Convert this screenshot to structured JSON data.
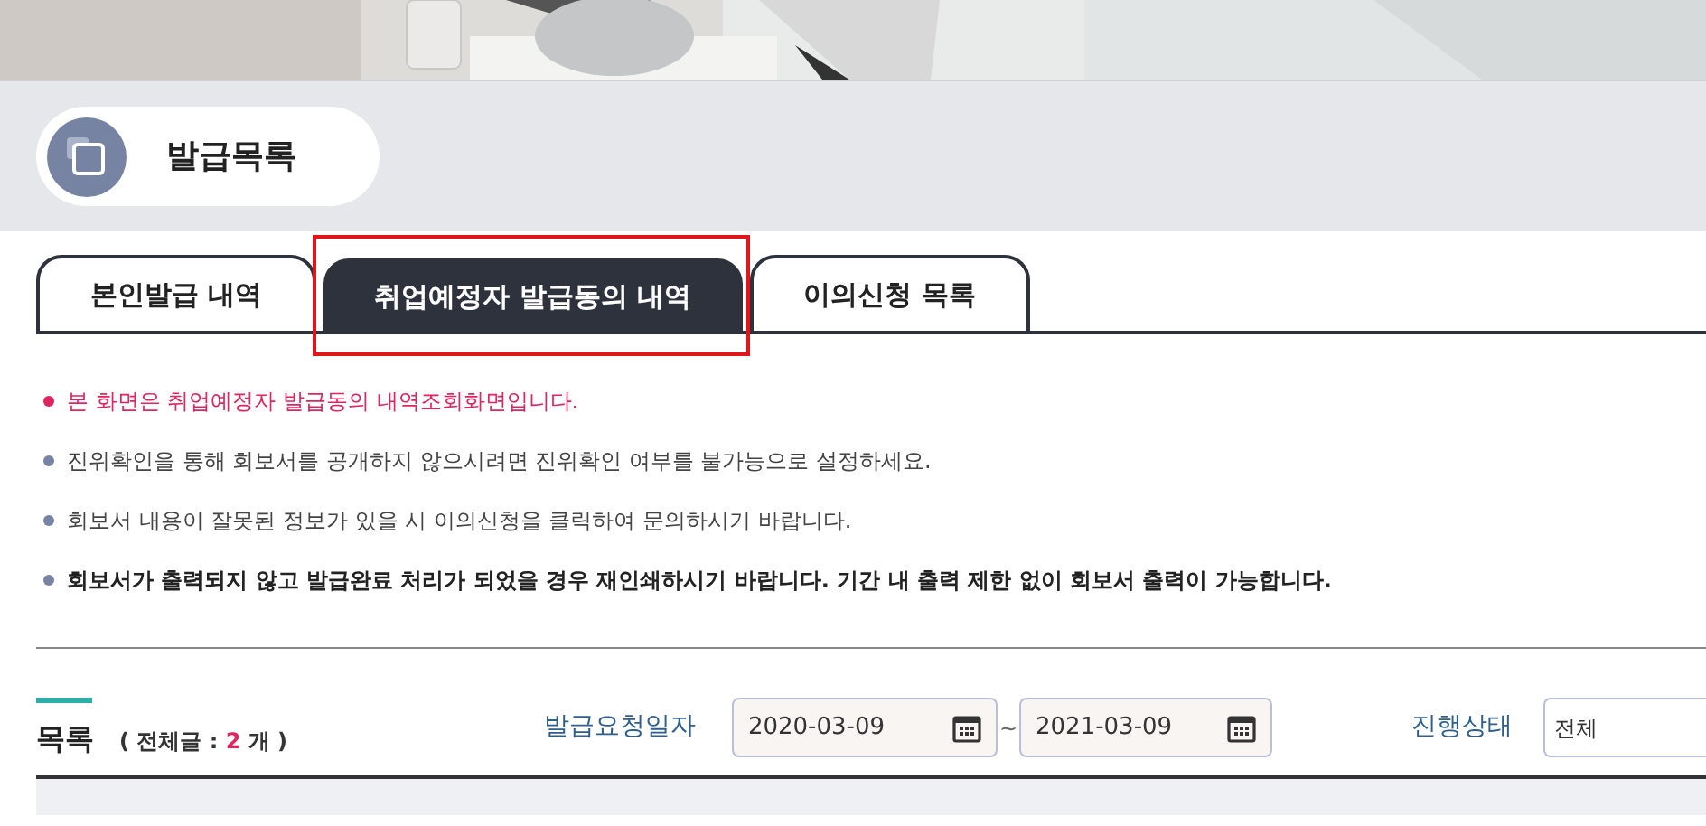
{
  "page_title": "발급목록",
  "tabs": [
    {
      "label": "본인발급 내역",
      "selected": false
    },
    {
      "label": "취업예정자 발급동의 내역",
      "selected": true
    },
    {
      "label": "이의신청 목록",
      "selected": false
    }
  ],
  "notices": [
    {
      "text": "본 화면은 취업예정자 발급동의 내역조회화면입니다.",
      "kind": "highlight"
    },
    {
      "text": "진위확인을 통해 회보서를 공개하지 않으시려면 진위확인 여부를 불가능으로 설정하세요.",
      "kind": "normal"
    },
    {
      "text": "회보서 내용이 잘못된 정보가 있을 시 이의신청을 클릭하여 문의하시기 바랍니다.",
      "kind": "normal"
    },
    {
      "text": "회보서가 출력되지 않고 발급완료 처리가 되었을 경우 재인쇄하시기 바랍니다. 기간 내 출력 제한 없이 회보서 출력이 가능합니다.",
      "kind": "bold"
    }
  ],
  "list": {
    "title": "목록",
    "count_prefix": "( 전체글 :",
    "count": "2",
    "count_suffix": "개 )",
    "date_label": "발급요청일자",
    "date_from": "2020-03-09",
    "date_sep": "~",
    "date_to": "2021-03-09",
    "status_label": "진행상태",
    "status_value": "전체"
  }
}
